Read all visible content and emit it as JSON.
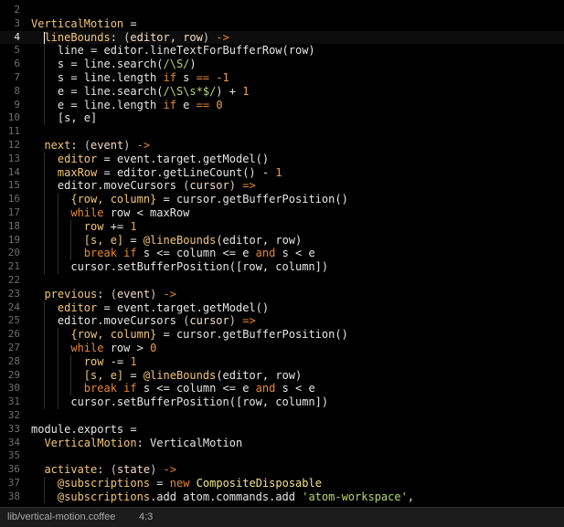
{
  "editor": {
    "cursor_line": 4,
    "lines": [
      {
        "n": "2",
        "tokens": []
      },
      {
        "n": "3",
        "tokens": [
          [
            "func",
            "VerticalMotion"
          ],
          [
            "plain",
            " ="
          ]
        ]
      },
      {
        "n": "4",
        "tokens": [
          [
            "plain",
            "  "
          ],
          [
            "func",
            "lineBounds"
          ],
          [
            "plain",
            ": "
          ],
          [
            "punct",
            "("
          ],
          [
            "param",
            "editor, row"
          ],
          [
            "punct",
            ")"
          ],
          [
            "plain",
            " "
          ],
          [
            "arrow",
            "->"
          ]
        ]
      },
      {
        "n": "5",
        "tokens": [
          [
            "plain",
            "    line = editor.lineTextForBufferRow(row)"
          ]
        ]
      },
      {
        "n": "6",
        "tokens": [
          [
            "plain",
            "    s = line.search("
          ],
          [
            "regex",
            "/\\S/"
          ],
          [
            "plain",
            ")"
          ]
        ]
      },
      {
        "n": "7",
        "tokens": [
          [
            "plain",
            "    s = line.length "
          ],
          [
            "kw",
            "if"
          ],
          [
            "plain",
            " s "
          ],
          [
            "kw",
            "=="
          ],
          [
            "plain",
            " "
          ],
          [
            "num",
            "-1"
          ]
        ]
      },
      {
        "n": "8",
        "tokens": [
          [
            "plain",
            "    e = line.search("
          ],
          [
            "regex",
            "/\\S\\s*$/"
          ],
          [
            "plain",
            ") + "
          ],
          [
            "num",
            "1"
          ]
        ]
      },
      {
        "n": "9",
        "tokens": [
          [
            "plain",
            "    e = line.length "
          ],
          [
            "kw",
            "if"
          ],
          [
            "plain",
            " e "
          ],
          [
            "kw",
            "=="
          ],
          [
            "plain",
            " "
          ],
          [
            "num",
            "0"
          ]
        ]
      },
      {
        "n": "10",
        "tokens": [
          [
            "plain",
            "    [s, e]"
          ]
        ]
      },
      {
        "n": "11",
        "tokens": []
      },
      {
        "n": "12",
        "tokens": [
          [
            "plain",
            "  "
          ],
          [
            "func",
            "next"
          ],
          [
            "plain",
            ": "
          ],
          [
            "punct",
            "("
          ],
          [
            "param",
            "event"
          ],
          [
            "punct",
            ")"
          ],
          [
            "plain",
            " "
          ],
          [
            "arrow",
            "->"
          ]
        ]
      },
      {
        "n": "13",
        "tokens": [
          [
            "plain",
            "    "
          ],
          [
            "func",
            "editor"
          ],
          [
            "plain",
            " = event.target.getModel()"
          ]
        ]
      },
      {
        "n": "14",
        "tokens": [
          [
            "plain",
            "    "
          ],
          [
            "func",
            "maxRow"
          ],
          [
            "plain",
            " = editor.getLineCount() - "
          ],
          [
            "num",
            "1"
          ]
        ]
      },
      {
        "n": "15",
        "tokens": [
          [
            "plain",
            "    editor.moveCursors "
          ],
          [
            "punct",
            "("
          ],
          [
            "param",
            "cursor"
          ],
          [
            "punct",
            ")"
          ],
          [
            "plain",
            " "
          ],
          [
            "arrow",
            "=>"
          ]
        ]
      },
      {
        "n": "16",
        "tokens": [
          [
            "plain",
            "      "
          ],
          [
            "func",
            "{row, column}"
          ],
          [
            "plain",
            " = cursor.getBufferPosition()"
          ]
        ]
      },
      {
        "n": "17",
        "tokens": [
          [
            "plain",
            "      "
          ],
          [
            "kw",
            "while"
          ],
          [
            "plain",
            " row < maxRow"
          ]
        ]
      },
      {
        "n": "18",
        "tokens": [
          [
            "plain",
            "        "
          ],
          [
            "func",
            "row"
          ],
          [
            "plain",
            " += "
          ],
          [
            "num",
            "1"
          ]
        ]
      },
      {
        "n": "19",
        "tokens": [
          [
            "plain",
            "        "
          ],
          [
            "func",
            "[s, e]"
          ],
          [
            "plain",
            " = "
          ],
          [
            "ivar",
            "@lineBounds"
          ],
          [
            "plain",
            "(editor, row)"
          ]
        ]
      },
      {
        "n": "20",
        "tokens": [
          [
            "plain",
            "        "
          ],
          [
            "kw",
            "break"
          ],
          [
            "plain",
            " "
          ],
          [
            "kw",
            "if"
          ],
          [
            "plain",
            " s <= column <= e "
          ],
          [
            "kw",
            "and"
          ],
          [
            "plain",
            " s < e"
          ]
        ]
      },
      {
        "n": "21",
        "tokens": [
          [
            "plain",
            "      cursor.setBufferPosition([row, column])"
          ]
        ]
      },
      {
        "n": "22",
        "tokens": []
      },
      {
        "n": "23",
        "tokens": [
          [
            "plain",
            "  "
          ],
          [
            "func",
            "previous"
          ],
          [
            "plain",
            ": "
          ],
          [
            "punct",
            "("
          ],
          [
            "param",
            "event"
          ],
          [
            "punct",
            ")"
          ],
          [
            "plain",
            " "
          ],
          [
            "arrow",
            "->"
          ]
        ]
      },
      {
        "n": "24",
        "tokens": [
          [
            "plain",
            "    "
          ],
          [
            "func",
            "editor"
          ],
          [
            "plain",
            " = event.target.getModel()"
          ]
        ]
      },
      {
        "n": "25",
        "tokens": [
          [
            "plain",
            "    editor.moveCursors "
          ],
          [
            "punct",
            "("
          ],
          [
            "param",
            "cursor"
          ],
          [
            "punct",
            ")"
          ],
          [
            "plain",
            " "
          ],
          [
            "arrow",
            "=>"
          ]
        ]
      },
      {
        "n": "26",
        "tokens": [
          [
            "plain",
            "      "
          ],
          [
            "func",
            "{row, column}"
          ],
          [
            "plain",
            " = cursor.getBufferPosition()"
          ]
        ]
      },
      {
        "n": "27",
        "tokens": [
          [
            "plain",
            "      "
          ],
          [
            "kw",
            "while"
          ],
          [
            "plain",
            " row > "
          ],
          [
            "num",
            "0"
          ]
        ]
      },
      {
        "n": "28",
        "tokens": [
          [
            "plain",
            "        "
          ],
          [
            "func",
            "row"
          ],
          [
            "plain",
            " -= "
          ],
          [
            "num",
            "1"
          ]
        ]
      },
      {
        "n": "29",
        "tokens": [
          [
            "plain",
            "        "
          ],
          [
            "func",
            "[s, e]"
          ],
          [
            "plain",
            " = "
          ],
          [
            "ivar",
            "@lineBounds"
          ],
          [
            "plain",
            "(editor, row)"
          ]
        ]
      },
      {
        "n": "30",
        "tokens": [
          [
            "plain",
            "        "
          ],
          [
            "kw",
            "break"
          ],
          [
            "plain",
            " "
          ],
          [
            "kw",
            "if"
          ],
          [
            "plain",
            " s <= column <= e "
          ],
          [
            "kw",
            "and"
          ],
          [
            "plain",
            " s < e"
          ]
        ]
      },
      {
        "n": "31",
        "tokens": [
          [
            "plain",
            "      cursor.setBufferPosition([row, column])"
          ]
        ]
      },
      {
        "n": "32",
        "tokens": []
      },
      {
        "n": "33",
        "tokens": [
          [
            "plain",
            "module.exports ="
          ]
        ]
      },
      {
        "n": "34",
        "tokens": [
          [
            "plain",
            "  "
          ],
          [
            "func",
            "VerticalMotion"
          ],
          [
            "plain",
            ": VerticalMotion"
          ]
        ]
      },
      {
        "n": "35",
        "tokens": []
      },
      {
        "n": "36",
        "tokens": [
          [
            "plain",
            "  "
          ],
          [
            "func",
            "activate"
          ],
          [
            "plain",
            ": "
          ],
          [
            "punct",
            "("
          ],
          [
            "param",
            "state"
          ],
          [
            "punct",
            ")"
          ],
          [
            "plain",
            " "
          ],
          [
            "arrow",
            "->"
          ]
        ]
      },
      {
        "n": "37",
        "tokens": [
          [
            "plain",
            "    "
          ],
          [
            "ivar",
            "@subscriptions"
          ],
          [
            "plain",
            " = "
          ],
          [
            "kw",
            "new"
          ],
          [
            "plain",
            " "
          ],
          [
            "class",
            "CompositeDisposable"
          ]
        ]
      },
      {
        "n": "38",
        "tokens": [
          [
            "plain",
            "    "
          ],
          [
            "ivar",
            "@subscriptions"
          ],
          [
            "plain",
            ".add atom.commands.add "
          ],
          [
            "str",
            "'atom-workspace'"
          ],
          [
            "plain",
            ","
          ]
        ]
      }
    ]
  },
  "status": {
    "file_path": "lib/vertical-motion.coffee",
    "cursor_position": "4:3"
  }
}
